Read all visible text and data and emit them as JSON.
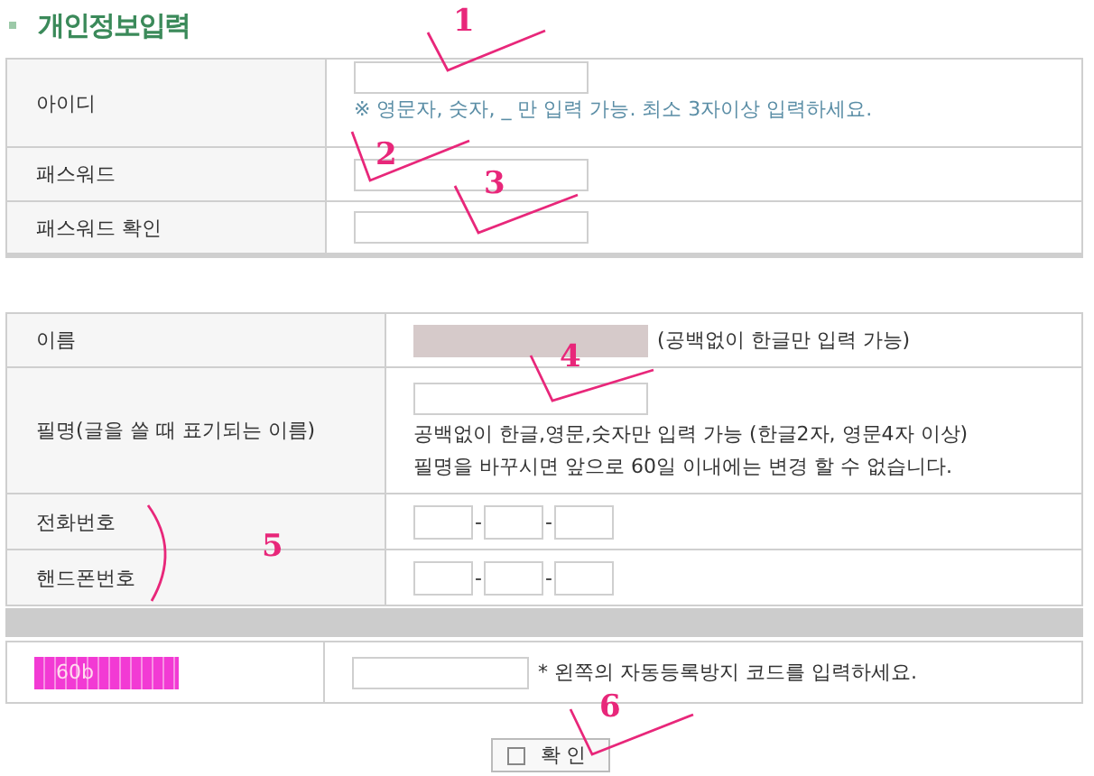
{
  "title": "개인정보입력",
  "account_rows": [
    {
      "label": "아이디",
      "hint": "※ 영문자, 숫자, _ 만 입력 가능. 최소 3자이상 입력하세요."
    },
    {
      "label": "패스워드"
    },
    {
      "label": "패스워드 확인"
    }
  ],
  "profile": {
    "name": {
      "label": "이름",
      "note": "(공백없이 한글만 입력 가능)",
      "disabled": true
    },
    "nickname": {
      "label": "필명(글을 쓸 때 표기되는 이름)",
      "notes": [
        "공백없이 한글,영문,숫자만 입력 가능 (한글2자, 영문4자 이상)",
        "필명을 바꾸시면 앞으로 60일 이내에는 변경 할 수 없습니다."
      ]
    },
    "phones": [
      {
        "label": "전화번호",
        "separators": [
          "-",
          "-"
        ]
      },
      {
        "label": "핸드폰번호",
        "separators": [
          "-",
          "-"
        ]
      }
    ]
  },
  "captcha": {
    "code": "60b",
    "note": "* 왼쪽의 자동등록방지 코드를 입력하세요."
  },
  "submit": {
    "label": "확 인"
  },
  "annotations": [
    {
      "number": "1"
    },
    {
      "number": "2"
    },
    {
      "number": "3"
    },
    {
      "number": "4"
    },
    {
      "number": "5"
    },
    {
      "number": "6"
    }
  ]
}
